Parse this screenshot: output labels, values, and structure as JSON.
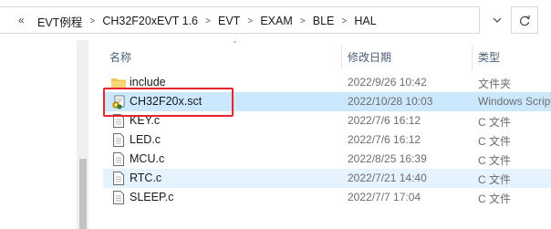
{
  "address_bar": {
    "overflow": "«",
    "crumbs": [
      "EVT例程",
      "CH32F20xEVT 1.6",
      "EVT",
      "EXAM",
      "BLE",
      "HAL"
    ]
  },
  "columns": {
    "name": "名称",
    "date": "修改日期",
    "type": "类型"
  },
  "files": [
    {
      "name": "include",
      "date": "2022/9/26 10:42",
      "type": "文件夹",
      "icon": "folder-icon"
    },
    {
      "name": "CH32F20x.sct",
      "date": "2022/10/28 10:03",
      "type": "Windows Script",
      "icon": "script-file-icon"
    },
    {
      "name": "KEY.c",
      "date": "2022/7/6 16:12",
      "type": "C 文件",
      "icon": "c-file-icon"
    },
    {
      "name": "LED.c",
      "date": "2022/7/6 16:12",
      "type": "C 文件",
      "icon": "c-file-icon"
    },
    {
      "name": "MCU.c",
      "date": "2022/8/25 16:39",
      "type": "C 文件",
      "icon": "c-file-icon"
    },
    {
      "name": "RTC.c",
      "date": "2022/7/21 14:40",
      "type": "C 文件",
      "icon": "c-file-icon"
    },
    {
      "name": "SLEEP.c",
      "date": "2022/7/7 17:04",
      "type": "C 文件",
      "icon": "c-file-icon"
    }
  ],
  "selected_file": "CH32F20x.sct",
  "colors": {
    "selection": "#cce8ff",
    "hover": "#e5f3ff",
    "highlight_box": "#e8242c",
    "folder": "#f0c35b"
  }
}
